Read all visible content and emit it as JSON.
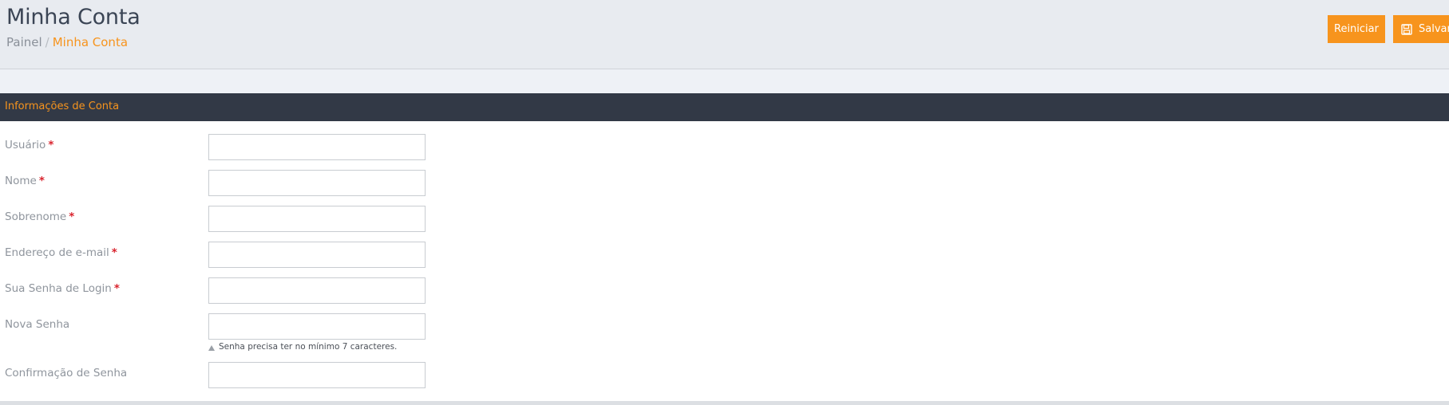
{
  "header": {
    "title": "Minha Conta",
    "breadcrumb": {
      "home": "Painel",
      "separator": "/",
      "current": "Minha Conta"
    },
    "buttons": {
      "reset_label": "Reiniciar",
      "save_label": "Salvar",
      "save_icon": "floppy-disk-icon"
    }
  },
  "section": {
    "title": "Informações de Conta"
  },
  "form": {
    "fields": [
      {
        "label": "Usuário",
        "required": true,
        "value": ""
      },
      {
        "label": "Nome",
        "required": true,
        "value": ""
      },
      {
        "label": "Sobrenome",
        "required": true,
        "value": ""
      },
      {
        "label": "Endereço de e-mail",
        "required": true,
        "value": ""
      },
      {
        "label": "Sua Senha de Login",
        "required": true,
        "value": ""
      },
      {
        "label": "Nova Senha",
        "required": false,
        "value": ""
      },
      {
        "label": "Confirmação de Senha",
        "required": false,
        "value": ""
      }
    ],
    "required_marker": "*",
    "password_hint": "Senha precisa ter no mínimo 7 caracteres."
  },
  "colors": {
    "accent": "#f7941d",
    "section_bar": "#323946",
    "required": "#d9232d"
  }
}
